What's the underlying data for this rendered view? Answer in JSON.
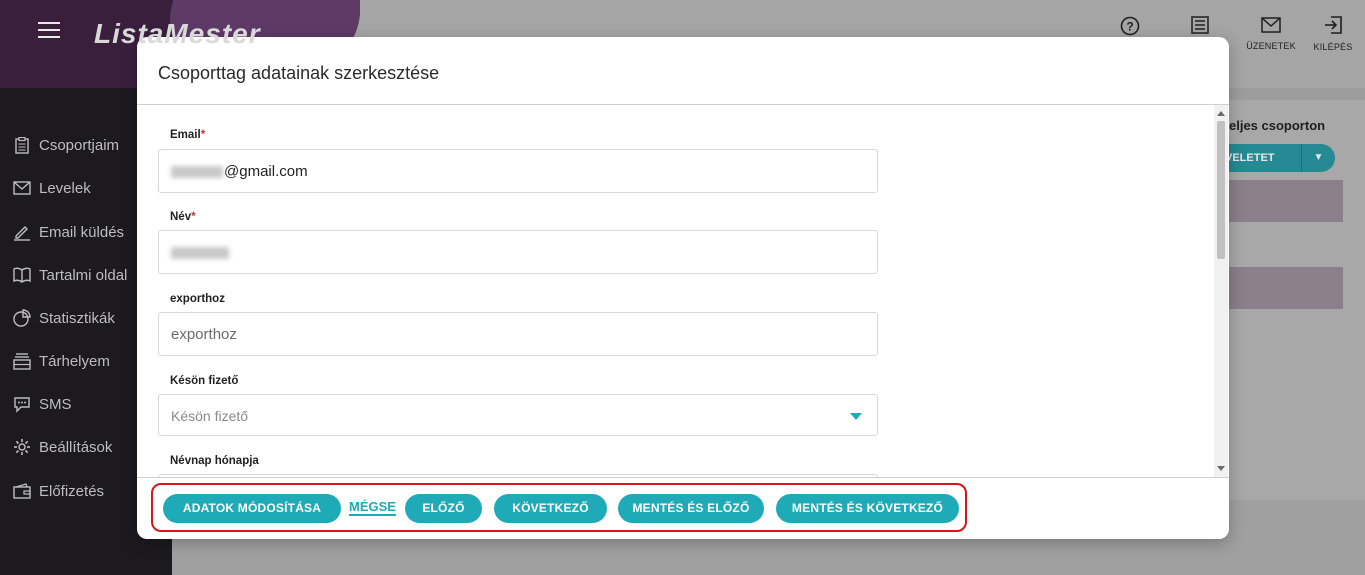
{
  "brand": {
    "logo_text": "ListaMester"
  },
  "topbar": {
    "icons": [
      {
        "name": "help",
        "glyph": "?",
        "label": ""
      },
      {
        "name": "list",
        "glyph": "☰",
        "label": ""
      },
      {
        "name": "messages",
        "glyph": "✉",
        "label": "ÜZENETEK"
      },
      {
        "name": "logout",
        "glyph": "⇥",
        "label": "KILÉPÉS"
      }
    ]
  },
  "sidebar": {
    "items": [
      {
        "label": "Csoportjaim",
        "icon": "clipboard-icon"
      },
      {
        "label": "Levelek",
        "icon": "envelope-icon"
      },
      {
        "label": "Email küldés",
        "icon": "pen-icon"
      },
      {
        "label": "Tartalmi oldal",
        "icon": "book-icon"
      },
      {
        "label": "Statisztikák",
        "icon": "pie-chart-icon"
      },
      {
        "label": "Tárhelyem",
        "icon": "storage-icon"
      },
      {
        "label": "SMS",
        "icon": "chat-icon"
      },
      {
        "label": "Beállítások",
        "icon": "gear-icon"
      },
      {
        "label": "Előfizetés",
        "icon": "wallet-icon"
      }
    ]
  },
  "background": {
    "right_label": "eljes csoporton",
    "right_button": "VELETET"
  },
  "modal": {
    "title": "Csoporttag adatainak szerkesztése",
    "fields": {
      "email": {
        "label": "Email",
        "value": "@gmail.com"
      },
      "name": {
        "label": "Név"
      },
      "exporthoz": {
        "label": "exporthoz",
        "placeholder": "exporthoz"
      },
      "keson": {
        "label": "Késön fizető",
        "placeholder": "Késön fizető"
      },
      "nevnap": {
        "label": "Névnap hónapja"
      }
    },
    "footer": {
      "modify": "ADATOK MÓDOSÍTÁSA",
      "cancel": "MÉGSE",
      "prev": "ELŐZŐ",
      "next": "KÖVETKEZŐ",
      "save_prev": "MENTÉS ÉS ELŐZŐ",
      "save_next": "MENTÉS ÉS KÖVETKEZŐ"
    }
  }
}
